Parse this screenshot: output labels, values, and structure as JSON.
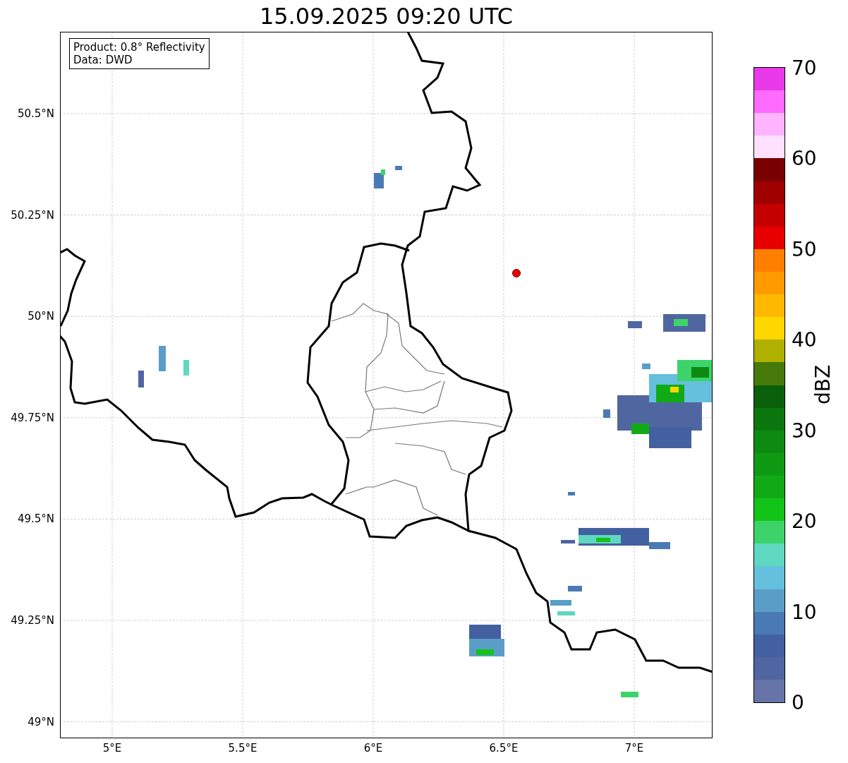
{
  "title": "15.09.2025 09:20 UTC",
  "info_box": [
    "Product: 0.8° Reflectivity",
    "Data: DWD"
  ],
  "map": {
    "y_ticks": [
      "50.5°N",
      "50.25°N",
      "50°N",
      "49.75°N",
      "49.5°N",
      "49.25°N",
      "49°N"
    ],
    "x_ticks": [
      "5°E",
      "5.5°E",
      "6°E",
      "6.5°E",
      "7°E"
    ]
  },
  "colorbar": {
    "label": "dBZ",
    "ticks": [
      "70",
      "60",
      "50",
      "40",
      "30",
      "20",
      "10",
      "0"
    ],
    "segments": [
      {
        "color": "#e83ae8"
      },
      {
        "color": "#ff6aff"
      },
      {
        "color": "#ffb4ff"
      },
      {
        "color": "#ffe0ff"
      },
      {
        "color": "#780000"
      },
      {
        "color": "#a00000"
      },
      {
        "color": "#c40000"
      },
      {
        "color": "#e60000"
      },
      {
        "color": "#ff7f00"
      },
      {
        "color": "#ff9b00"
      },
      {
        "color": "#ffb800"
      },
      {
        "color": "#ffd700"
      },
      {
        "color": "#b0b000"
      },
      {
        "color": "#457a0a"
      },
      {
        "color": "#0a5f0a"
      },
      {
        "color": "#0b780f"
      },
      {
        "color": "#0d8a12"
      },
      {
        "color": "#0f9a14"
      },
      {
        "color": "#10aa16"
      },
      {
        "color": "#12c418"
      },
      {
        "color": "#3cd46a"
      },
      {
        "color": "#5fd8c2"
      },
      {
        "color": "#64c0dc"
      },
      {
        "color": "#5a9ec8"
      },
      {
        "color": "#4a7ab4"
      },
      {
        "color": "#4360a0"
      },
      {
        "color": "#5066a0"
      },
      {
        "color": "#6674a8"
      }
    ]
  }
}
